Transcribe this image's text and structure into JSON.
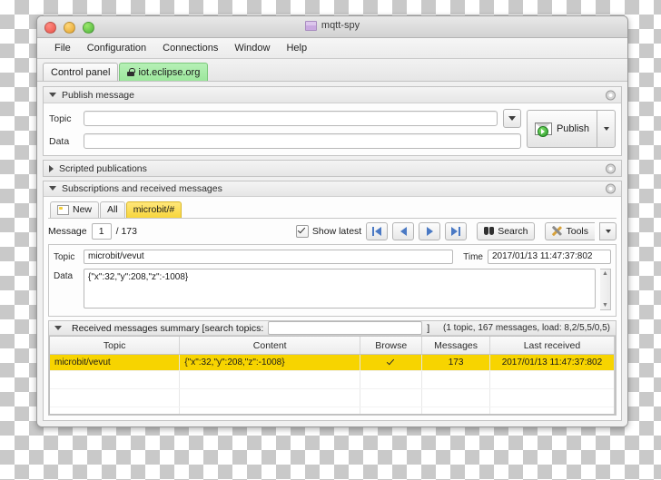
{
  "window": {
    "title": "mqtt-spy",
    "traffic_lights": [
      "close-button",
      "minimize-button",
      "zoom-button"
    ]
  },
  "menubar": {
    "items": [
      {
        "label": "File"
      },
      {
        "label": "Configuration"
      },
      {
        "label": "Connections"
      },
      {
        "label": "Window"
      },
      {
        "label": "Help"
      }
    ]
  },
  "connection_tabs": [
    {
      "label": "Control panel",
      "active": false,
      "locked": false
    },
    {
      "label": "iot.eclipse.org",
      "active": true,
      "locked": true
    }
  ],
  "publish_panel": {
    "title": "Publish message",
    "expanded": true,
    "topic_label": "Topic",
    "topic_value": "",
    "topic_placeholder": "",
    "data_label": "Data",
    "data_value": "",
    "data_placeholder": "",
    "publish_label": "Publish"
  },
  "scripted_panel": {
    "title": "Scripted publications",
    "expanded": false
  },
  "subscriptions_panel": {
    "title": "Subscriptions and received messages",
    "expanded": true,
    "tabs": [
      {
        "label": "New",
        "active": false,
        "icon": "new-tab-icon"
      },
      {
        "label": "All",
        "active": false
      },
      {
        "label": "microbit/#",
        "active": true
      }
    ],
    "message_label": "Message",
    "message_index": "1",
    "message_separator": "/ 173",
    "show_latest_label": "Show latest",
    "show_latest_checked": true,
    "nav_buttons": [
      {
        "name": "first-message-button"
      },
      {
        "name": "previous-message-button"
      },
      {
        "name": "next-message-button"
      },
      {
        "name": "last-message-button"
      }
    ],
    "search_label": "Search",
    "tools_label": "Tools"
  },
  "message_detail": {
    "topic_label": "Topic",
    "topic_value": "microbit/vevut",
    "time_label": "Time",
    "time_value": "2017/01/13 11:47:37:802",
    "data_label": "Data",
    "data_value": "{\"x\":32,\"y\":208,\"z\":-1008}"
  },
  "summary_panel": {
    "title": "Received messages summary [search topics:",
    "title_suffix": "]",
    "expanded": true,
    "search_value": "",
    "search_placeholder": "",
    "stats": "(1 topic, 167 messages, load: 8,2/5,5/0,5)",
    "columns": [
      "Topic",
      "Content",
      "Browse",
      "Messages",
      "Last received"
    ],
    "rows": [
      {
        "topic": "microbit/vevut",
        "content": "{\"x\":32,\"y\":208,\"z\":-1008}",
        "browse": true,
        "messages": "173",
        "last_received": "2017/01/13 11:47:37:802",
        "selected": true
      }
    ],
    "empty_row_count": 3
  },
  "colors": {
    "selection_yellow": "#f7d400",
    "active_tab_yellow": "#f7d63c",
    "connected_green": "#9ce79c",
    "nav_arrow_blue": "#4a79c4"
  }
}
